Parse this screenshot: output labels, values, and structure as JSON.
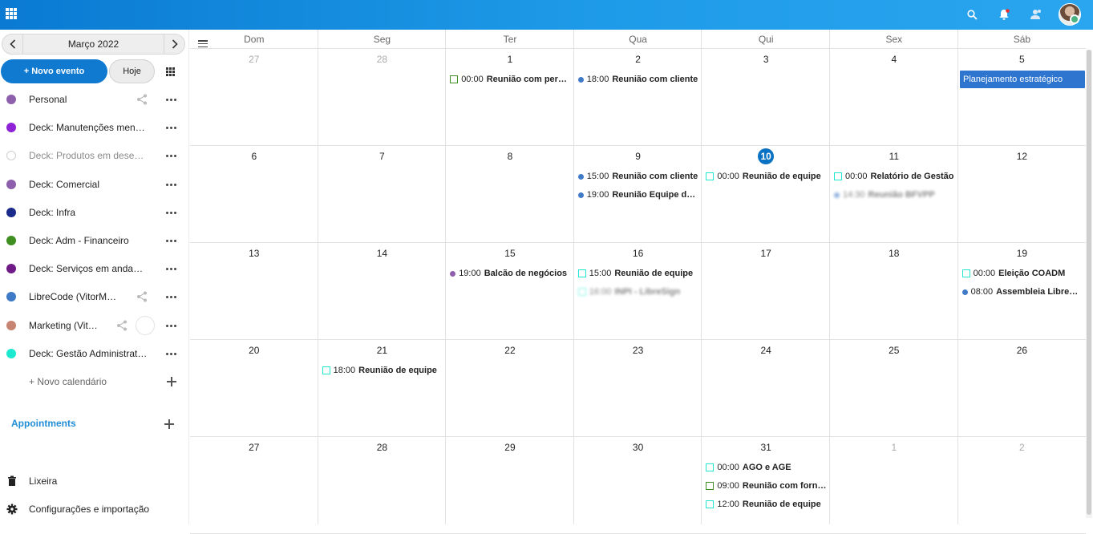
{
  "sidebar": {
    "month_label": "Março 2022",
    "new_event_label": "+ Novo evento",
    "today_label": "Hoje",
    "calendars": [
      {
        "name": "Personal",
        "color": "#8e5fad",
        "shared": true
      },
      {
        "name": "Deck: Manutenções mens…",
        "color": "#8f22d6",
        "shared": false
      },
      {
        "name": "Deck: Produtos em desen…",
        "color": "#ffffff",
        "shared": false,
        "muted": true
      },
      {
        "name": "Deck: Comercial",
        "color": "#8e5fad",
        "shared": false
      },
      {
        "name": "Deck: Infra",
        "color": "#1a2b8c",
        "shared": false
      },
      {
        "name": "Deck: Adm - Financeiro",
        "color": "#3e8f1f",
        "shared": false
      },
      {
        "name": "Deck: Serviços em andam…",
        "color": "#6f1a86",
        "shared": false
      },
      {
        "name": "LibreCode (VitorMa…",
        "color": "#3f7ac7",
        "shared": true
      },
      {
        "name": "Marketing (Vit…",
        "color": "#c88472",
        "shared": true
      },
      {
        "name": "Deck: Gestão Administrati…",
        "color": "#1de9d0",
        "shared": false
      }
    ],
    "new_calendar_label": "+ Novo calendário",
    "appointments_label": "Appointments",
    "trash_label": "Lixeira",
    "settings_label": "Configurações e importação"
  },
  "calendar": {
    "weekdays": [
      "Dom",
      "Seg",
      "Ter",
      "Qua",
      "Qui",
      "Sex",
      "Sáb"
    ],
    "weeks": [
      [
        "27",
        "28",
        "1",
        "2",
        "3",
        "4",
        "5"
      ],
      [
        "6",
        "7",
        "8",
        "9",
        "10",
        "11",
        "12"
      ],
      [
        "13",
        "14",
        "15",
        "16",
        "17",
        "18",
        "19"
      ],
      [
        "20",
        "21",
        "22",
        "23",
        "24",
        "25",
        "26"
      ],
      [
        "27",
        "28",
        "29",
        "30",
        "31",
        "1",
        "2"
      ]
    ],
    "today": "10",
    "banner_event": "Planejamento estratégico",
    "events": [
      {
        "week": 0,
        "day": 2,
        "slot": 0,
        "time": "00:00",
        "title": "Reunião com perceiro",
        "marker": "box",
        "color": "#3e8f1f"
      },
      {
        "week": 0,
        "day": 3,
        "slot": 0,
        "time": "18:00",
        "title": "Reunião com cliente",
        "marker": "dot",
        "color": "#3f7ac7"
      },
      {
        "week": 1,
        "day": 3,
        "slot": 0,
        "time": "15:00",
        "title": "Reunião com cliente",
        "marker": "dot",
        "color": "#3f7ac7"
      },
      {
        "week": 1,
        "day": 3,
        "slot": 1,
        "time": "19:00",
        "title": "Reunião Equipe do for…",
        "marker": "dot",
        "color": "#3f7ac7"
      },
      {
        "week": 1,
        "day": 4,
        "slot": 0,
        "time": "00:00",
        "title": "Reunião de equipe",
        "marker": "box",
        "color": "#1de9d0"
      },
      {
        "week": 1,
        "day": 5,
        "slot": 0,
        "time": "00:00",
        "title": "Relatório de Gestão",
        "marker": "box",
        "color": "#1de9d0"
      },
      {
        "week": 1,
        "day": 5,
        "slot": 1,
        "time": "14:30",
        "title": "Reunião BFVPP",
        "marker": "dot",
        "color": "#3f7ac7",
        "blurred": true
      },
      {
        "week": 2,
        "day": 2,
        "slot": 0,
        "time": "19:00",
        "title": "Balcão de negócios",
        "marker": "dot",
        "color": "#8e5fad"
      },
      {
        "week": 2,
        "day": 3,
        "slot": 0,
        "time": "15:00",
        "title": "Reunião de equipe",
        "marker": "box",
        "color": "#1de9d0"
      },
      {
        "week": 2,
        "day": 3,
        "slot": 1,
        "time": "16:00",
        "title": "INPI - LibreSign",
        "marker": "box",
        "color": "#1de9d0",
        "blurred": true
      },
      {
        "week": 2,
        "day": 6,
        "slot": 0,
        "time": "00:00",
        "title": "Eleição COADM",
        "marker": "box",
        "color": "#1de9d0"
      },
      {
        "week": 2,
        "day": 6,
        "slot": 1,
        "time": "08:00",
        "title": "Assembleia LibreCode",
        "marker": "dot",
        "color": "#3f7ac7"
      },
      {
        "week": 3,
        "day": 1,
        "slot": 0,
        "time": "18:00",
        "title": "Reunião de equipe",
        "marker": "box",
        "color": "#1de9d0"
      },
      {
        "week": 4,
        "day": 4,
        "slot": 0,
        "time": "00:00",
        "title": "AGO e AGE",
        "marker": "box",
        "color": "#1de9d0"
      },
      {
        "week": 4,
        "day": 4,
        "slot": 1,
        "time": "09:00",
        "title": "Reunião com fornece…",
        "marker": "box",
        "color": "#3e8f1f"
      },
      {
        "week": 4,
        "day": 4,
        "slot": 2,
        "time": "12:00",
        "title": "Reunião de equipe",
        "marker": "box",
        "color": "#1de9d0"
      }
    ]
  }
}
